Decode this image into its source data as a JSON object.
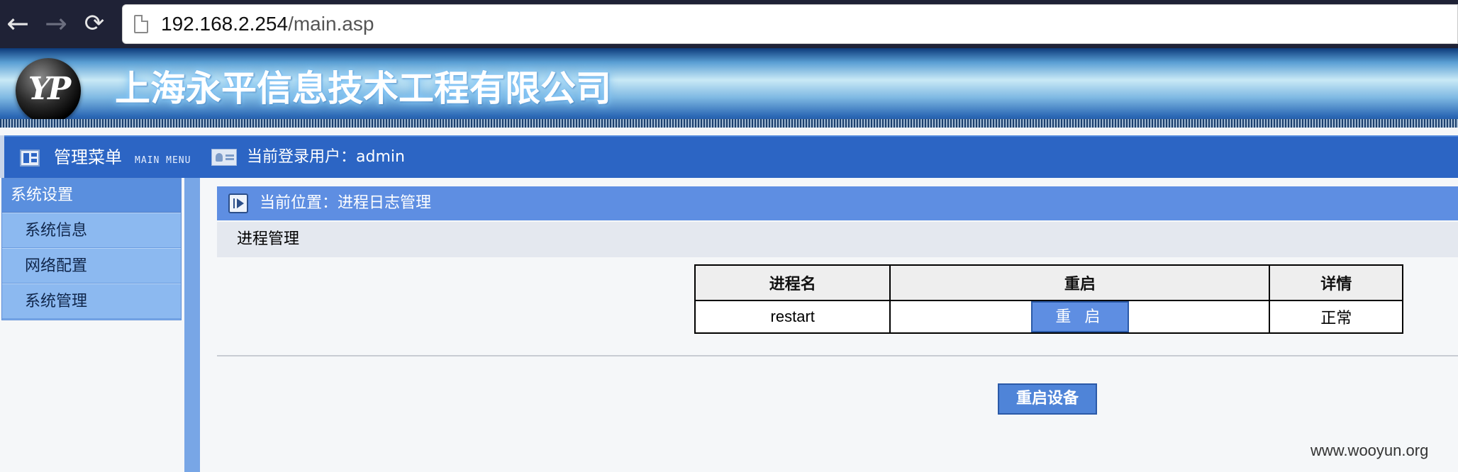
{
  "browser": {
    "url_host": "192.168.2.254",
    "url_path": "/main.asp",
    "back_icon": "←",
    "forward_icon": "→",
    "reload_icon": "⟳"
  },
  "banner": {
    "company_name": "上海永平信息技术工程有限公司",
    "logo_mark": "YP"
  },
  "menubar": {
    "title": "管理菜单",
    "subtitle": "MAIN MENU",
    "user_label": "当前登录用户：admin"
  },
  "sidebar": {
    "group_title": "系统设置",
    "items": [
      {
        "label": "系统信息"
      },
      {
        "label": "网络配置"
      },
      {
        "label": "系统管理"
      }
    ]
  },
  "main": {
    "location": "当前位置：进程日志管理",
    "section_title": "进程管理",
    "table": {
      "headers": [
        "进程名",
        "重启",
        "详情"
      ],
      "rows": [
        {
          "name": "restart",
          "button": "重 启",
          "detail": "正常"
        }
      ]
    },
    "device_restart_button": "重启设备"
  },
  "watermark": "www.wooyun.org",
  "colors": {
    "accent": "#5e8ee2",
    "menubar": "#2c65c4",
    "sidebar": "#8cb9f0"
  }
}
